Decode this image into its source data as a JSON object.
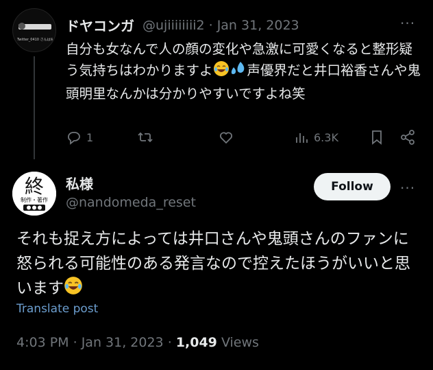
{
  "parent_tweet": {
    "display_name": "ドヤコンガ",
    "handle": "@ujiiiiiiii2",
    "separator": "·",
    "date": "Jan 31, 2023",
    "more_icon": "more-horizontal-icon",
    "avatar_caption": "Twitter_0410 さんは鳥をブロックしました",
    "text_part1": "自分も女なんで人の顔の変化や急激に可愛くなると整形疑う気持ちはわかりますよ",
    "text_part2": "声優界だと井口裕香さんや鬼頭明里なんかは分かりやすいですよね笑",
    "emoji_1": "face-with-tears-of-joy",
    "emoji_2": "sweat-droplets",
    "actions": {
      "reply_count": "1",
      "retweet_count": "",
      "like_count": "",
      "views_count": "6.3K"
    }
  },
  "main_tweet": {
    "display_name": "私様",
    "handle": "@nandomeda_reset",
    "follow_label": "Follow",
    "avatar_text": "終",
    "avatar_subtext": "制作・著作",
    "text": "それも捉え方によっては井口さんや鬼頭さんのファンに怒られる可能性のある発言なので控えたほうがいいと思います",
    "emoji": "face-with-tears-of-joy",
    "translate_label": "Translate post",
    "time": "4:03 PM",
    "separator": "·",
    "date": "Jan 31, 2023",
    "views_count": "1,049",
    "views_label": "Views"
  },
  "colors": {
    "background": "#000000",
    "text_primary": "#e7e9ea",
    "text_secondary": "#71767b",
    "link": "#6c9ecf",
    "button_bg": "#eff3f4"
  }
}
